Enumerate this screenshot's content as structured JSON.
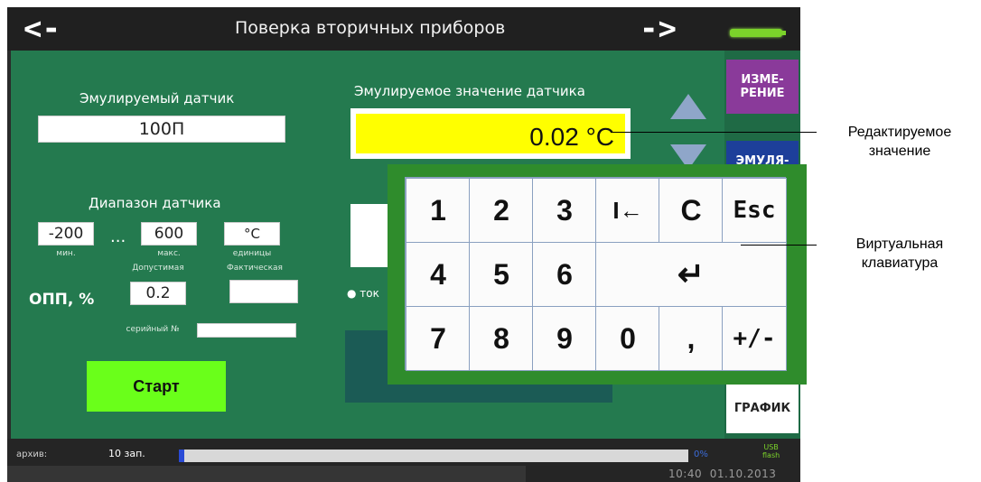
{
  "titlebar": {
    "back": "<-",
    "title": "Поверка вторичных приборов",
    "forward": "->"
  },
  "side": {
    "measure": "ИЗМЕ-\nРЕНИЕ",
    "emulation": "ЭМУЛЯ-\nЦИЯ",
    "graph": "ГРАФИК"
  },
  "sensor": {
    "label": "Эмулируемый датчик",
    "value": "100П"
  },
  "emulated": {
    "label": "Эмулируемое значение датчика",
    "value": "0.02 °C"
  },
  "range": {
    "label": "Диапазон датчика",
    "min": "-200",
    "min_caption": "мин.",
    "dots": "...",
    "max": "600",
    "max_caption": "макс.",
    "units": "°C",
    "units_caption": "единицы"
  },
  "opp": {
    "label": "ОПП, %",
    "allowed_caption": "Допустимая",
    "actual_caption": "Фактическая",
    "allowed": "0.2",
    "actual": ""
  },
  "serial": {
    "label": "серийный №",
    "value": ""
  },
  "start_label": "Старт",
  "tok_label": "ток",
  "keyboard": {
    "row1": [
      "1",
      "2",
      "3",
      "I←",
      "C",
      "Esc"
    ],
    "row2": [
      "4",
      "5",
      "6",
      "↵"
    ],
    "row3": [
      "7",
      "8",
      "9",
      "0",
      ",",
      "+/-"
    ]
  },
  "status": {
    "archive_label": "архив:",
    "records": "10 зап.",
    "progress_fraction": 0.01,
    "percent": "0%",
    "usb": "USB\nflash",
    "time": "10:40",
    "date": "01.10.2013"
  },
  "annotations": {
    "edited_value": "Редактируемое\nзначение",
    "virtual_keyboard": "Виртуальная\nклавиатура"
  },
  "colors": {
    "panel": "#247a4f",
    "value_bg": "#ffff00",
    "start_bg": "#6aff1a",
    "keyboard_frame": "#2f8c2c"
  }
}
